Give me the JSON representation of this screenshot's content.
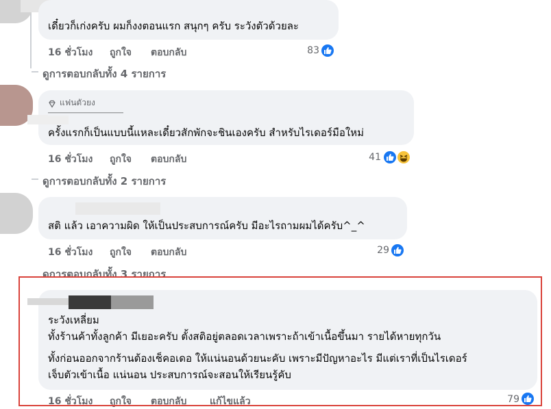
{
  "comments": [
    {
      "text": "เดี๋ยวก็เก่งครับ ผมก็งงตอนแรก สนุกๆ ครับ ระวังตัวด้วยละ",
      "time": "16 ชั่วโมง",
      "like": "ถูกใจ",
      "reply": "ตอบกลับ",
      "reaction_count": "83",
      "view_replies": "ดูการตอบกลับทั้ง 4 รายการ"
    },
    {
      "badge": "แฟนตัวยง",
      "text": "ครั้งแรกก็เป็นแบบนี้แหละเดี๋ยวสักพักจะชินเองครับ สำหรับไรเดอร์มือใหม่",
      "time": "16 ชั่วโมง",
      "like": "ถูกใจ",
      "reply": "ตอบกลับ",
      "reaction_count": "41",
      "view_replies": "ดูการตอบกลับทั้ง 2 รายการ"
    },
    {
      "text": "สติ แล้ว เอาความผิด ให้เป็นประสบการณ์ครับ มีอะไรถามผมได้ครับ^_^",
      "time": "16 ชั่วโมง",
      "like": "ถูกใจ",
      "reply": "ตอบกลับ",
      "reaction_count": "29",
      "view_replies": "ดูการตอบกลับทั้ง 3 รายการ"
    },
    {
      "line1": "ระวังเหลี่ยม",
      "line2": "ทั้งร้านค้าทั้งลูกค้า มีเยอะครับ ตั้งสติอยู่ตลอดเวลาเพราะถ้าเข้าเนื้อขึ้นมา รายได้หายทุกวัน",
      "line3": "ทั้งก่อนออกจากร้านต้องเช็คอเดอ ให้แน่นอนด้วยนะคับ เพราะมีปัญหาอะไร มีแต่เราที่เป็นไรเดอร์",
      "line4": "เจ็บตัวเข้าเนื้อ แน่นอน ประสบการณ์จะสอนให้เรียนรู้คับ",
      "time": "16 ชั่วโมง",
      "like": "ถูกใจ",
      "reply": "ตอบกลับ",
      "edited": "แก้ไขแล้ว",
      "reaction_count": "79"
    }
  ],
  "colors": {
    "bubble": "#f0f2f5",
    "meta_text": "#65676b",
    "like_blue": "#1877f2",
    "highlight": "#d9423a"
  }
}
